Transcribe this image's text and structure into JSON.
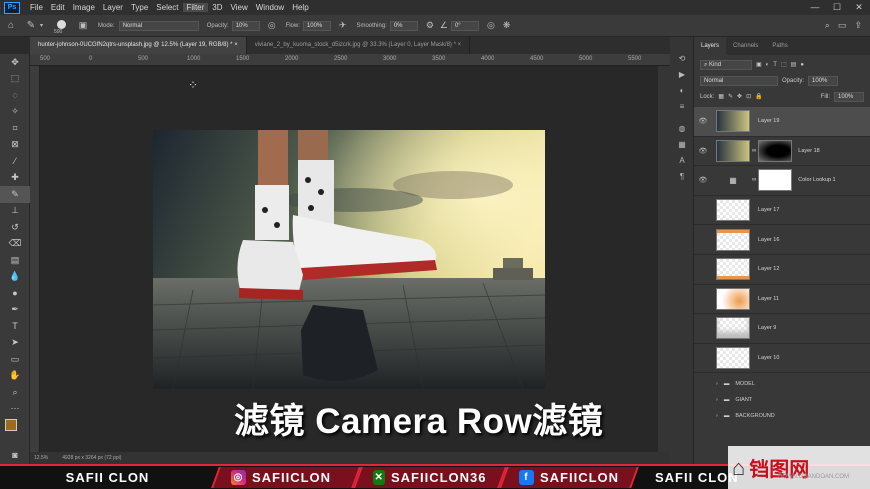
{
  "menu": {
    "logo": "Ps",
    "items": [
      "File",
      "Edit",
      "Image",
      "Layer",
      "Type",
      "Select",
      "Filter",
      "3D",
      "View",
      "Window",
      "Help"
    ],
    "active": "Filter"
  },
  "options": {
    "brush_size": "500",
    "mode_label": "Mode:",
    "mode_value": "Normal",
    "opacity_label": "Opacity:",
    "opacity_value": "10%",
    "flow_label": "Flow:",
    "flow_value": "100%",
    "smoothing_label": "Smoothing:",
    "smoothing_value": "0%",
    "angle_value": "0°"
  },
  "tabs": [
    {
      "label": "hunter-johnson-0UCGfN2qtrs-unsplash.jpg @ 12.5% (Layer 19, RGB/8) *",
      "close": "×"
    },
    {
      "label": "viviane_2_by_kuoma_stock_d5izcrk.jpg @ 33.3% (Layer 0, Layer Mask/8) *",
      "close": "×"
    }
  ],
  "ruler_ticks": [
    "500",
    "0",
    "500",
    "1000",
    "1500",
    "2000",
    "2500",
    "3000",
    "3500",
    "4000",
    "4500",
    "5000",
    "5500",
    "6000"
  ],
  "status": {
    "zoom": "12.5%",
    "size": "4928 px x 3264 px (72 ppi)"
  },
  "caption": "滤镜  Camera Row滤镜",
  "panel": {
    "tabs": [
      "Layers",
      "Channels",
      "Paths"
    ],
    "kind": "Kind",
    "blend": "Normal",
    "opacity_label": "Opacity:",
    "opacity_value": "100%",
    "lock_label": "Lock:",
    "fill_label": "Fill:",
    "fill_value": "100%",
    "layers": [
      {
        "name": "Layer 19",
        "selected": true
      },
      {
        "name": "Layer 18"
      },
      {
        "name": "Color Lookup 1"
      },
      {
        "name": "Layer 17"
      },
      {
        "name": "Layer 16"
      },
      {
        "name": "Layer 12"
      },
      {
        "name": "Layer 11"
      },
      {
        "name": "Layer 9"
      },
      {
        "name": "Layer 10"
      }
    ],
    "groups": [
      "MODEL",
      "GIANT",
      "BACKGROUND"
    ]
  },
  "footer": {
    "name": "SAFII CLON",
    "instagram": "SAFIICLON",
    "xbox": "SAFIICLON36",
    "facebook": "SAFIICLON",
    "partial": "SAFII CLON"
  },
  "watermark": {
    "logo": "铛图网",
    "url": "DOWN.GUANDOAN.COM"
  }
}
